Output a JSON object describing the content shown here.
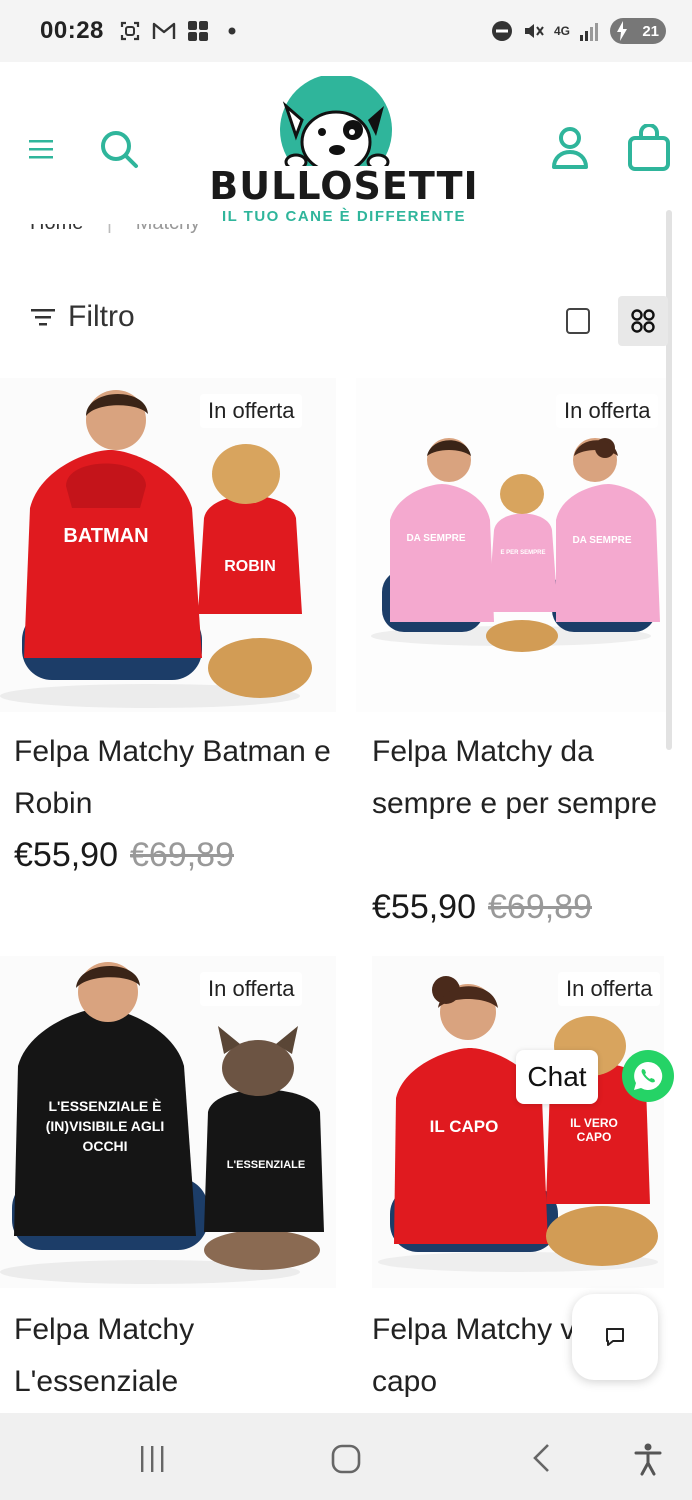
{
  "status_bar": {
    "time": "00:28",
    "battery": "21",
    "network": "4G",
    "icons": [
      "screenshot-icon",
      "gmail-icon",
      "app-icon",
      "dot-icon",
      "dnd-icon",
      "mute-icon",
      "signal-icon",
      "battery-icon"
    ]
  },
  "header": {
    "brand": "BULLOSETTI",
    "tagline": "IL TUO CANE È DIFFERENTE",
    "accent_color": "#2fb59b"
  },
  "breadcrumb": {
    "home": "Home",
    "separator": "|",
    "current": "Matchy"
  },
  "filter": {
    "label": "Filtro"
  },
  "products": [
    {
      "badge": "In offerta",
      "title": "Felpa Matchy Batman e Robin",
      "price": "€55,90",
      "old_price": "€69,89",
      "image_text": [
        "BATMAN",
        "ROBIN"
      ],
      "color": "#e01a1f"
    },
    {
      "badge": "In offerta",
      "title": "Felpa Matchy da sempre e per sempre",
      "price": "€55,90",
      "old_price": "€69,89",
      "image_text": [
        "DA SEMPRE",
        "E PER SEMPRE",
        "DA SEMPRE"
      ],
      "color": "#f4a9cf"
    },
    {
      "badge": "In offerta",
      "title": "Felpa Matchy L'essenziale",
      "image_text": [
        "L'ESSENZIALE È (IN)VISIBILE AGLI OCCHI",
        "L'ESSENZIALE"
      ],
      "color": "#151515"
    },
    {
      "badge": "In offerta",
      "title": "Felpa Matchy vero capo",
      "image_text": [
        "IL CAPO",
        "IL VERO CAPO"
      ],
      "color": "#e01a1f"
    }
  ],
  "chat": {
    "label": "Chat"
  }
}
